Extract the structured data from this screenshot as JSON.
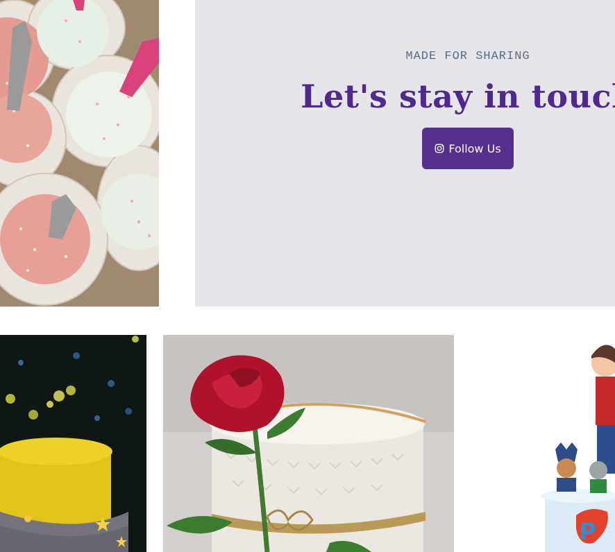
{
  "promo": {
    "eyebrow": "MADE FOR SHARING",
    "headline": "Let's stay in touch",
    "follow_button": {
      "label": "Follow Us",
      "icon": "instagram-icon"
    },
    "colors": {
      "panel_bg": "#e6e6ea",
      "headline": "#4e2a8e",
      "button_bg": "#54318f",
      "eyebrow": "#5b6b80"
    }
  }
}
